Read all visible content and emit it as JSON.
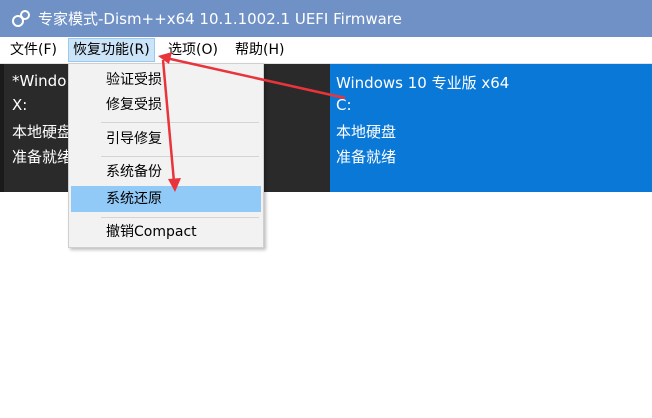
{
  "window": {
    "title": "专家模式-Dism++x64 10.1.1002.1 UEFI Firmware",
    "titlebar_color": "#6f91c6",
    "icon": "dism-app-icon"
  },
  "menubar": {
    "items": [
      {
        "label": "文件(F)"
      },
      {
        "label": "恢复功能(R)",
        "active": true
      },
      {
        "label": "选项(O)"
      },
      {
        "label": "帮助(H)"
      }
    ]
  },
  "systems": [
    {
      "name": "*Windo",
      "drive": "X:",
      "disk": "本地硬盘",
      "status": "准备就绪",
      "color": "#2a2a2a"
    },
    {
      "name": "Windows 10 专业版 x64",
      "drive": "C:",
      "disk": "本地硬盘",
      "status": "准备就绪",
      "color": "#0a78d7",
      "selected": true
    }
  ],
  "dropdown": {
    "items": [
      {
        "label": "验证受损"
      },
      {
        "label": "修复受损"
      },
      {
        "label": "引导修复"
      },
      {
        "label": "系统备份"
      },
      {
        "label": "系统还原",
        "highlighted": true
      },
      {
        "label": "撤销Compact"
      }
    ],
    "highlight_color": "#91c9f7"
  },
  "annotation": {
    "arrow_color": "#e8343a"
  }
}
